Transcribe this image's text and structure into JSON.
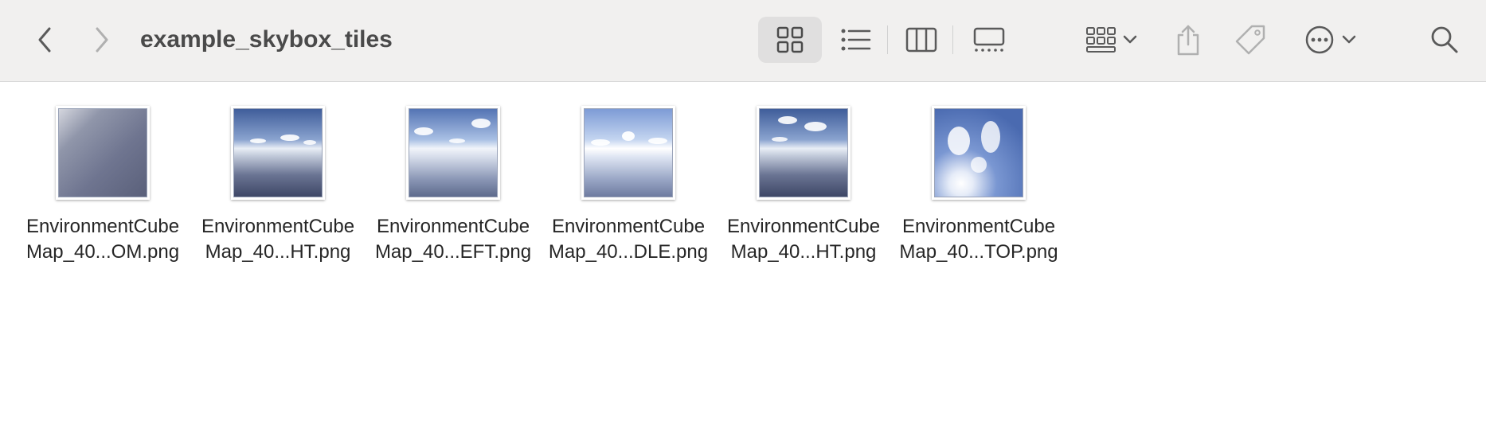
{
  "window": {
    "title": "example_skybox_tiles"
  },
  "toolbar": {
    "back_icon": "chevron-left-icon",
    "forward_icon": "chevron-right-icon",
    "view_modes": [
      "icon-view",
      "list-view",
      "column-view",
      "gallery-view"
    ],
    "selected_view": "icon-view",
    "group_icon": "group-by-icon",
    "share_icon": "share-icon",
    "tag_icon": "tag-icon",
    "more_icon": "ellipsis-circle-icon",
    "search_icon": "search-icon"
  },
  "files": [
    {
      "line1": "EnvironmentCube",
      "line2": "Map_40...OM.png",
      "thumb": "bottom"
    },
    {
      "line1": "EnvironmentCube",
      "line2": "Map_40...HT.png",
      "thumb": "horizon-dark"
    },
    {
      "line1": "EnvironmentCube",
      "line2": "Map_40...EFT.png",
      "thumb": "horizon-light"
    },
    {
      "line1": "EnvironmentCube",
      "line2": "Map_40...DLE.png",
      "thumb": "horizon-bright"
    },
    {
      "line1": "EnvironmentCube",
      "line2": "Map_40...HT.png",
      "thumb": "horizon-dark"
    },
    {
      "line1": "EnvironmentCube",
      "line2": "Map_40...TOP.png",
      "thumb": "top"
    }
  ],
  "colors": {
    "toolbar_bg": "#f1f0ef",
    "selected_view_bg": "#e0dfdf",
    "icon": "#5a5a5a",
    "icon_disabled": "#b0b0b0"
  }
}
